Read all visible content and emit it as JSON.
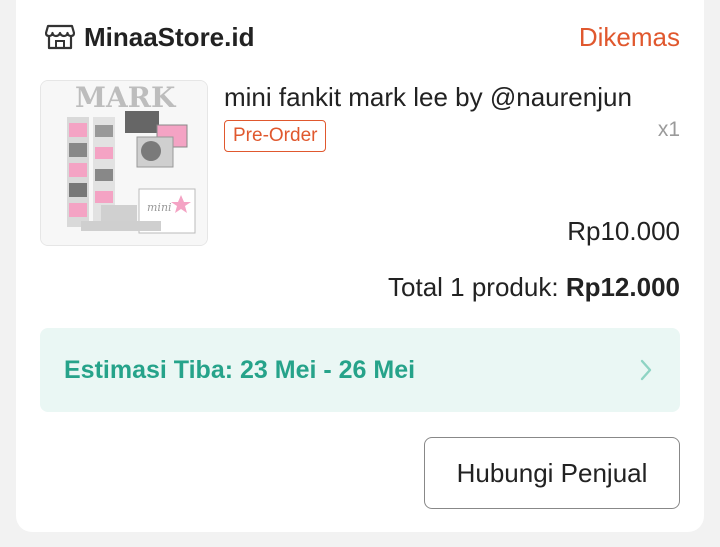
{
  "order": {
    "store_name": "MinaaStore.id",
    "status": "Dikemas",
    "store_icon": "store-icon"
  },
  "product": {
    "title": "mini fankit mark lee by @naurenjun",
    "badge": "Pre-Order",
    "quantity": "x1",
    "price": "Rp10.000",
    "thumbnail_text": "MARK"
  },
  "summary": {
    "total_label": "Total 1 produk:",
    "total_value": "Rp12.000"
  },
  "delivery": {
    "eta": "Estimasi Tiba: 23 Mei - 26 Mei",
    "icon": "chevron-right-icon"
  },
  "actions": {
    "contact_seller": "Hubungi Penjual"
  },
  "colors": {
    "accent": "#e0582e",
    "eta_text": "#26a38a",
    "eta_bg": "#eaf7f4"
  }
}
